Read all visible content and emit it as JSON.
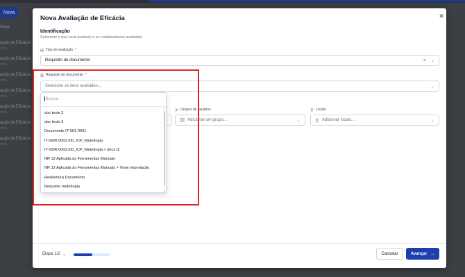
{
  "background": {
    "new_button": "Nova",
    "sidebar_label": "Status",
    "rows": [
      {
        "title": "ação de Eficácia",
        "sub": "2025"
      },
      {
        "title": "ação de Eficácia",
        "sub": "2025"
      },
      {
        "title": "ação de Eficácia",
        "sub": "2025"
      },
      {
        "title": "ação de Eficácia",
        "sub": "2025"
      },
      {
        "title": "ação de Eficácia",
        "sub": "2025"
      },
      {
        "title": "ação de Eficácia",
        "sub": "2025"
      },
      {
        "title": "ação de Eficácia",
        "sub": "2025"
      }
    ]
  },
  "modal": {
    "title": "Nova Avaliação de Eficácia",
    "close_icon": "close-icon",
    "section_title": "Identificação",
    "section_subtitle": "Selecione o que será avaliado e os colaboradores avaliados",
    "tipo": {
      "label": "Tipo de avaliação",
      "required_mark": "*",
      "icon": "target-icon",
      "value": "Requisito de documento"
    },
    "requisito": {
      "label": "Requisito de documento",
      "required_mark": "*",
      "icon": "document-icon",
      "placeholder": "Selecione os itens avaliados..."
    },
    "grupos": {
      "label": "Grupos de usuários",
      "icon": "users-icon",
      "placeholder": "Adicionar um grupo..."
    },
    "locais": {
      "label": "Locais",
      "icon": "location-icon",
      "placeholder": "Adicionar locais..."
    },
    "dropdown": {
      "search_placeholder": "Buscar...",
      "items": [
        "doc teste 2",
        "doc teste 3",
        "Documento IT-001-0001",
        "IT-SDR-0003.r00_ICP_Metrologia",
        "IT-SDR-0003.r00_ICP_Metrologia > docs t2",
        "NR 12 Aplicada às Ferramentas Manuais",
        "NR 12 Aplicada às Ferramentas Manuais > Teste Importação",
        "Reabertura Documento",
        "Requisito metrologia"
      ]
    },
    "footer": {
      "step": "Etapa 1/2",
      "progress": 0.5,
      "cancel": "Cancelar",
      "next": "Avançar"
    }
  },
  "colors": {
    "primary": "#1e40af",
    "highlight": "#dc2626"
  }
}
